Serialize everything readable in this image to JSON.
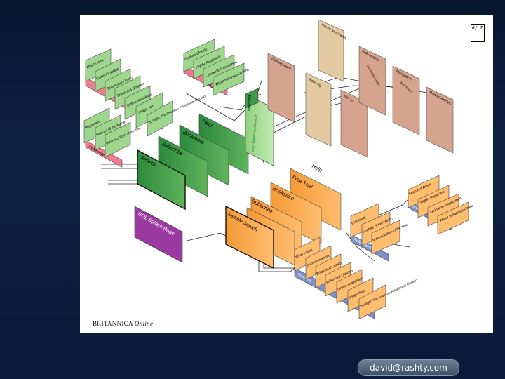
{
  "page_id": "d/ D",
  "caption": {
    "brand": "BRITANNICA",
    "product": "Online"
  },
  "footer_email": "david@rashty.com",
  "colors": {
    "pink": "#f27a8e",
    "green_light": "#9fd68e",
    "green": "#3f9a48",
    "orange": "#f59b3a",
    "blue": "#7e90c8",
    "purple": "#9b3aa0",
    "brown": "#d6a38e",
    "tan": "#e4caa0"
  },
  "labels": {
    "tl_whats_new": "What's New",
    "tl_current_interest": "Current Interest",
    "tl_brit_lives": "Britannica's Lives",
    "tl_brit_classics": "Britannica Classics",
    "tl_online_newsletter": "Online Newsletter",
    "tl_image_tour": "Image Tour",
    "tl_spotlight": "Spotlight: The American Presidential Election",
    "tl_features": "Features",
    "tl_proposals": "Proposals",
    "tl_feature_month": "Feature of the Month",
    "tl_britannica_book": "Britannica Book of the Year",
    "tl_references": "References",
    "tm_feature_article": "Featured Article",
    "tm_highly_regarded": "Highly Regarded",
    "tm_leonardo": "Leonardo Transcribed",
    "tm_about_online": "About Britannica Online",
    "tm_more": "More",
    "g_help": "Help",
    "g_bookstore": "Bookstore",
    "g_subscribe": "Subscribe",
    "g_search": "Search",
    "g_dictionary": "Dictionary",
    "g_dictionary_sub": "Dictionary Thesaurus Links",
    "p_splash": "BOL Splash Page",
    "r_glossary": "Glossary Book",
    "r_pieces": "Pieces and Topics",
    "r_index_article": "Index Article",
    "r_index_sub": "Text Pictures Tables",
    "r_microarticle": "Microarticle",
    "r_micro_sub": "Text Pictures",
    "r_related": "Related Articles",
    "r_index": "Index Pg",
    "r_hit_list": "Hit List",
    "o_help": "Help",
    "o_free_trial": "Free Trial",
    "o_bookstore": "Bookstore",
    "o_subscribe": "Subscribe",
    "o_sample_search": "Sample Search",
    "o_feature_article": "Featured Article",
    "o_highly_regarded": "Highly Regarded",
    "o_leonardo": "Leonardo Transcribed",
    "o_about_online": "About Britannica Online",
    "o_more": "More",
    "o_proposals": "Proposals",
    "o_feature_month": "Feature of the Month",
    "o_britannica_book": "Britannica Book of the Year",
    "o_references": "References",
    "o_whats_new": "What's New",
    "o_current_interest": "Current Interest",
    "o_brit_lives": "Britannica's Lives",
    "o_brit_classics": "Britannica Classics",
    "o_online_newsletter": "Online Newsletter",
    "o_image_tour": "Image Tour",
    "o_spotlight": "Spotlight: The American Presidential Election",
    "o_features": "Features"
  }
}
